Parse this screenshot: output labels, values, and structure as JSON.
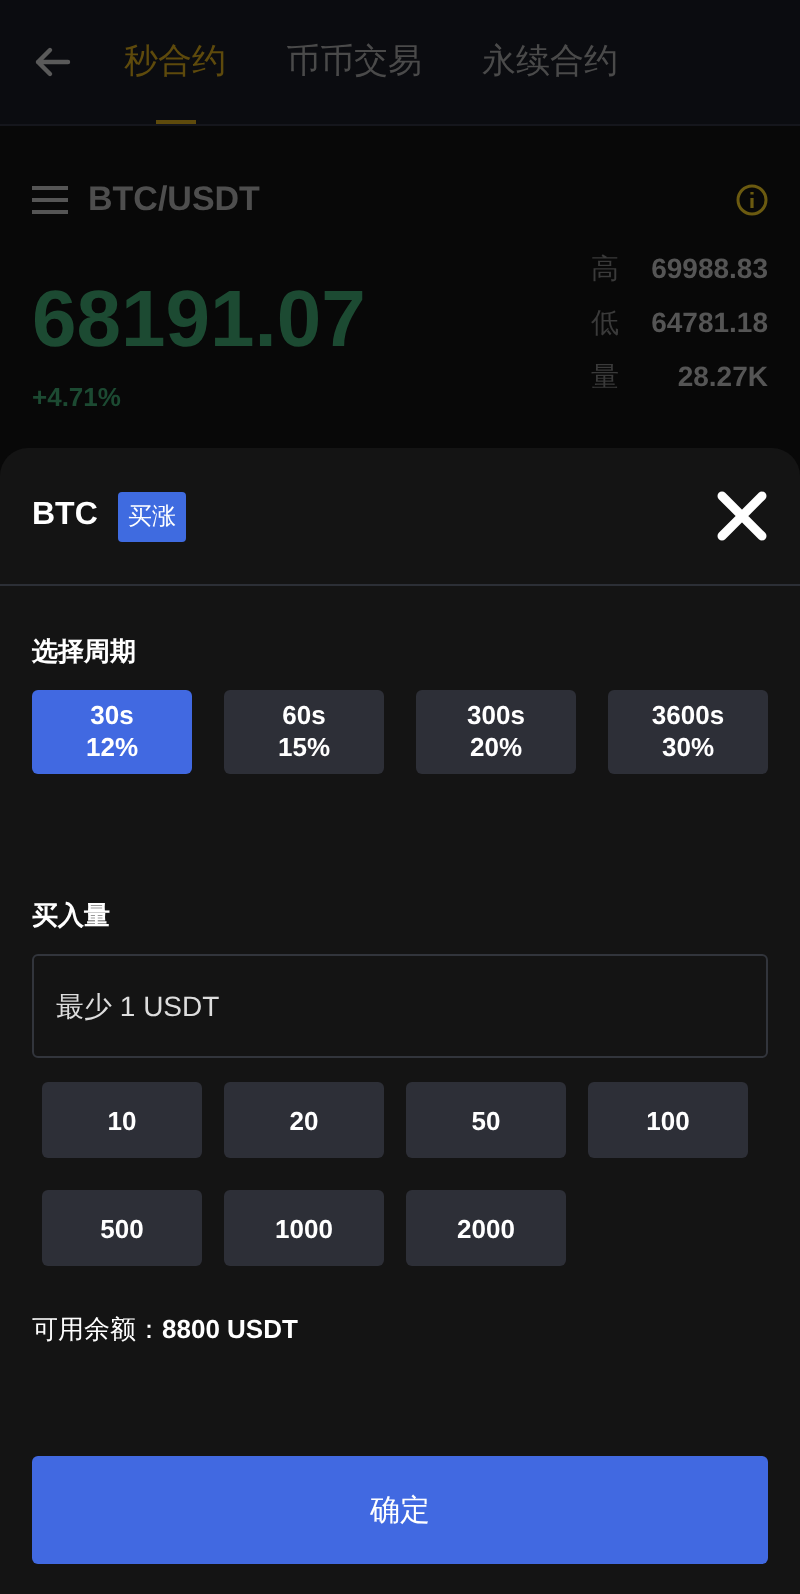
{
  "nav": {
    "tabs": [
      {
        "label": "秒合约",
        "selected": true
      },
      {
        "label": "币币交易",
        "selected": false
      },
      {
        "label": "永续合约",
        "selected": false
      }
    ]
  },
  "market": {
    "pair": "BTC/USDT",
    "price": "68191.07",
    "change": "+4.71%",
    "stats": [
      {
        "label": "高",
        "value": "69988.83"
      },
      {
        "label": "低",
        "value": "64781.18"
      },
      {
        "label": "量",
        "value": "28.27K"
      }
    ]
  },
  "sheet": {
    "coin": "BTC",
    "direction": "买涨",
    "period_title": "选择周期",
    "periods": [
      {
        "time": "30s",
        "rate": "12%",
        "selected": true
      },
      {
        "time": "60s",
        "rate": "15%",
        "selected": false
      },
      {
        "time": "300s",
        "rate": "20%",
        "selected": false
      },
      {
        "time": "3600s",
        "rate": "30%",
        "selected": false
      }
    ],
    "amount_title": "买入量",
    "amount_field": {
      "placeholder": "最少 1 USDT"
    },
    "presets": [
      "10",
      "20",
      "50",
      "100",
      "500",
      "1000",
      "2000"
    ],
    "balance_label": "可用余额：",
    "balance_value": "8800 USDT",
    "confirm": "确定"
  }
}
